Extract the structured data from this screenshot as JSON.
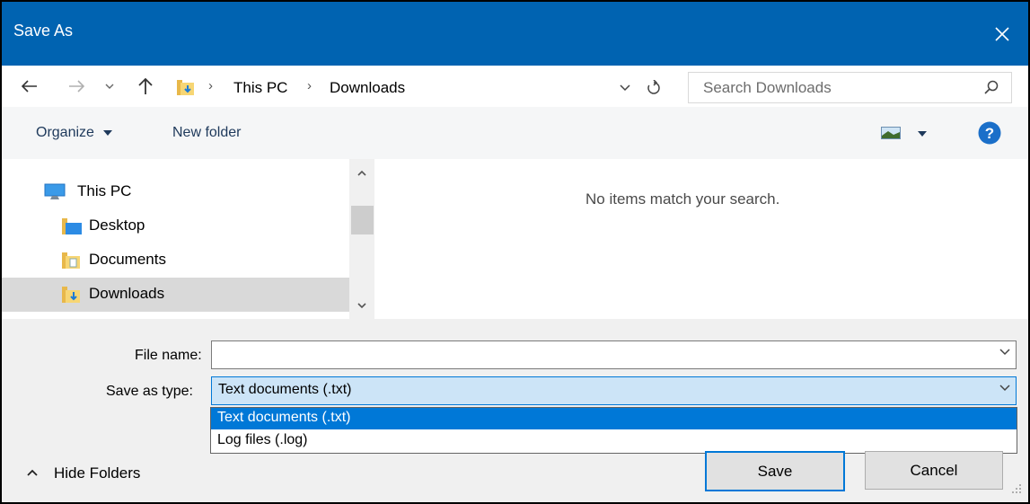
{
  "window": {
    "title": "Save As"
  },
  "address": {
    "breadcrumbs": [
      "This PC",
      "Downloads"
    ],
    "search_placeholder": "Search Downloads"
  },
  "toolbar": {
    "organize_label": "Organize",
    "new_folder_label": "New folder"
  },
  "nav_pane": {
    "items": [
      {
        "label": "This PC",
        "icon": "computer-icon"
      },
      {
        "label": "Desktop",
        "icon": "desktop-folder-icon"
      },
      {
        "label": "Documents",
        "icon": "documents-folder-icon"
      },
      {
        "label": "Downloads",
        "icon": "downloads-folder-icon",
        "selected": true
      }
    ]
  },
  "content": {
    "empty_message": "No items match your search."
  },
  "form": {
    "file_name_label": "File name:",
    "file_name_value": "",
    "save_type_label": "Save as type:",
    "save_type_value": "Text documents (.txt)",
    "save_type_options": [
      "Text documents (.txt)",
      "Log files (.log)"
    ]
  },
  "buttons": {
    "save": "Save",
    "cancel": "Cancel",
    "hide_folders": "Hide Folders"
  },
  "colors": {
    "titlebar": "#0063b1",
    "selection": "#0078d7",
    "nav_selected": "#d9d9d9"
  }
}
